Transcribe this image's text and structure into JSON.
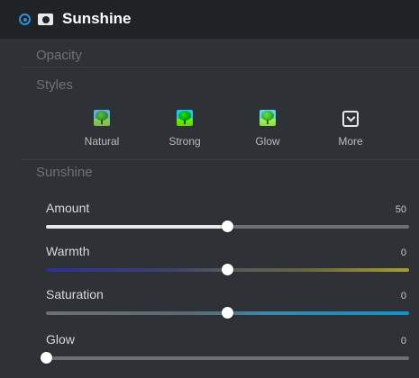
{
  "header": {
    "title": "Sunshine",
    "radio_icon": "radio-selected-icon",
    "mask_icon": "layer-mask-icon",
    "accent_color": "#2b8fd9"
  },
  "sections": {
    "opacity_label": "Opacity",
    "styles_label": "Styles",
    "sunshine_label": "Sunshine"
  },
  "styles": [
    {
      "label": "Natural",
      "icon": "tree-thumbnail"
    },
    {
      "label": "Strong",
      "icon": "tree-thumbnail"
    },
    {
      "label": "Glow",
      "icon": "tree-thumbnail"
    },
    {
      "label": "More",
      "icon": "chevron-down-box-icon"
    }
  ],
  "sliders": [
    {
      "label": "Amount",
      "value": "50",
      "min": 0,
      "max": 100,
      "position": 0.5
    },
    {
      "label": "Warmth",
      "value": "0",
      "min": -100,
      "max": 100,
      "position": 0.5
    },
    {
      "label": "Saturation",
      "value": "0",
      "min": -100,
      "max": 100,
      "position": 0.5
    },
    {
      "label": "Glow",
      "value": "0",
      "min": 0,
      "max": 100,
      "position": 0.0
    }
  ]
}
